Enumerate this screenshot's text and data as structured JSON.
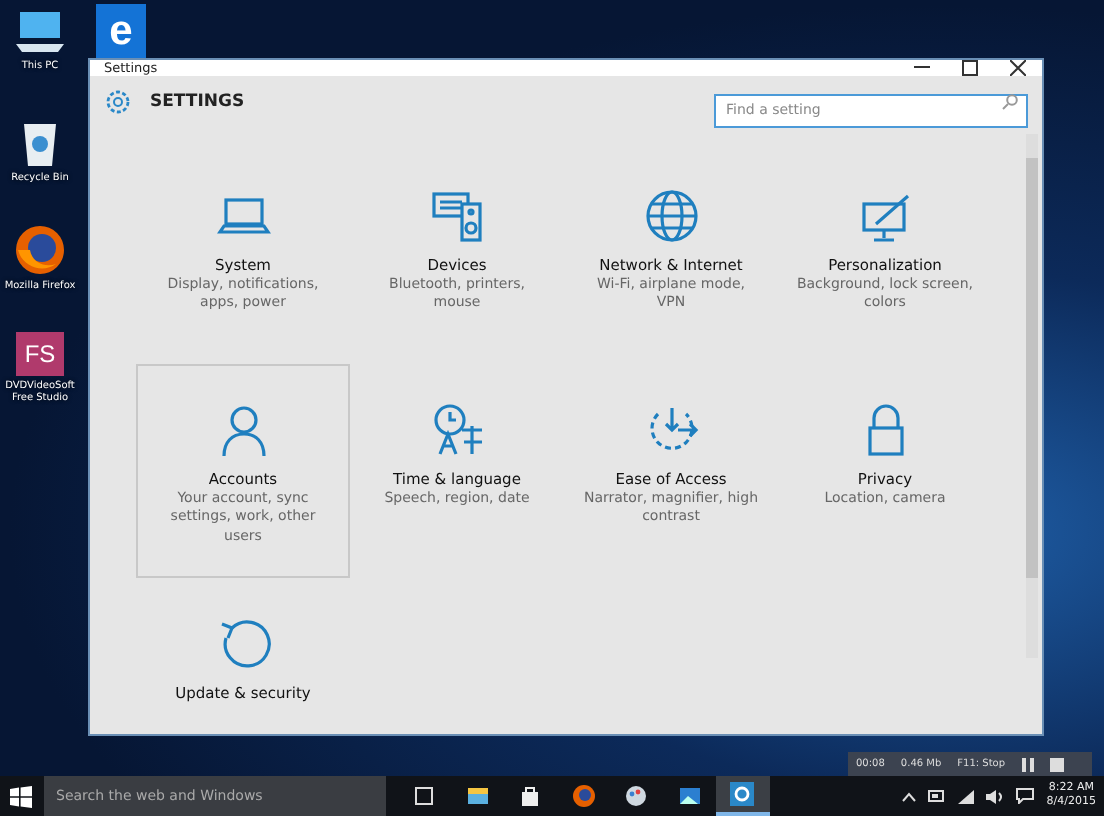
{
  "desktop_icons": [
    {
      "kind": "pc",
      "label": "This PC"
    },
    {
      "kind": "bin",
      "label": "Recycle Bin"
    },
    {
      "kind": "firefox",
      "label": "Mozilla Firefox"
    },
    {
      "kind": "fs",
      "label": "DVDVideoSoft Free Studio",
      "glyph": "FS"
    }
  ],
  "edge_shortcut": {
    "glyph": "e"
  },
  "window": {
    "title": "Settings",
    "header": "SETTINGS",
    "search": {
      "placeholder": "Find a setting"
    },
    "tiles": [
      {
        "kind": "system",
        "title": "System",
        "description": "Display, notifications, apps, power",
        "selected": false
      },
      {
        "kind": "devices",
        "title": "Devices",
        "description": "Bluetooth, printers, mouse",
        "selected": false
      },
      {
        "kind": "network",
        "title": "Network & Internet",
        "description": "Wi-Fi, airplane mode, VPN",
        "selected": false
      },
      {
        "kind": "personalization",
        "title": "Personalization",
        "description": "Background, lock screen, colors",
        "selected": false
      },
      {
        "kind": "accounts",
        "title": "Accounts",
        "description": "Your account, sync settings, work, other users",
        "selected": true
      },
      {
        "kind": "time",
        "title": "Time & language",
        "description": "Speech, region, date",
        "selected": false
      },
      {
        "kind": "ease",
        "title": "Ease of Access",
        "description": "Narrator, magnifier, high contrast",
        "selected": false
      },
      {
        "kind": "privacy",
        "title": "Privacy",
        "description": "Location, camera",
        "selected": false
      },
      {
        "kind": "update",
        "title": "Update & security",
        "selected": false
      }
    ]
  },
  "recorder": {
    "elapsed": "00:08",
    "size": "0.46 Mb",
    "hotkey": "F11: Stop"
  },
  "taskbar": {
    "search": {
      "placeholder": "Search the web and Windows"
    },
    "apps": [
      {
        "kind": "task-view",
        "active": false
      },
      {
        "kind": "explorer",
        "active": false
      },
      {
        "kind": "store",
        "active": false
      },
      {
        "kind": "firefox",
        "active": false
      },
      {
        "kind": "paint",
        "active": false
      },
      {
        "kind": "photos",
        "active": false
      },
      {
        "kind": "settings",
        "active": true
      }
    ],
    "clock": {
      "time": "8:22 AM",
      "date": "8/4/2015"
    }
  }
}
